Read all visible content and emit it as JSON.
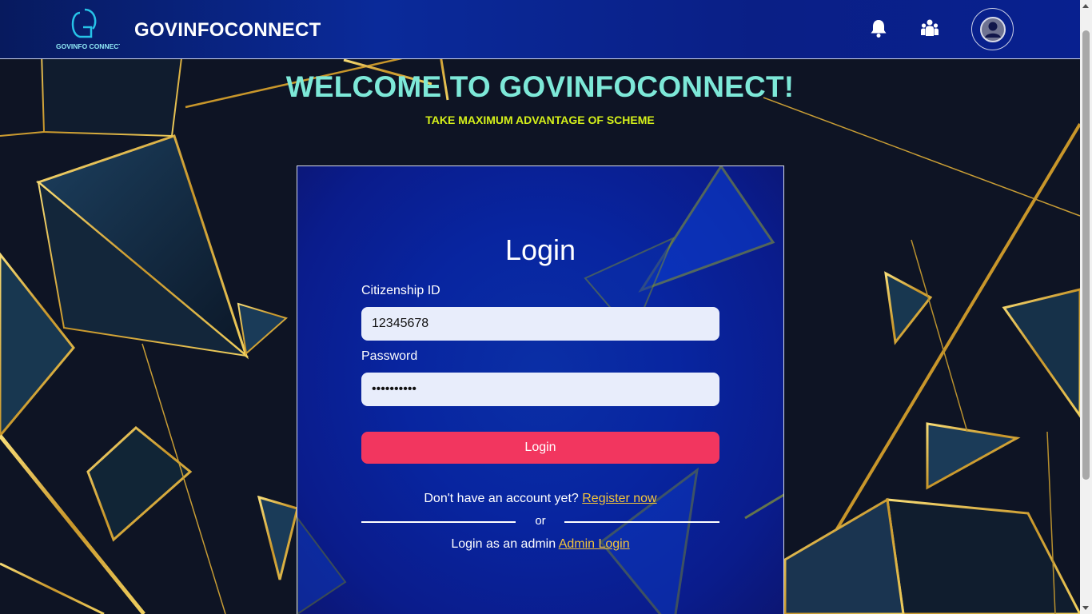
{
  "header": {
    "logo_text": "GOVINFO CONNECT",
    "brand": "GOVINFOCONNECT",
    "icons": [
      "bell-icon",
      "people-icon",
      "user-avatar-icon"
    ]
  },
  "hero": {
    "welcome": "WELCOME TO GOVINFOCONNECT!",
    "tagline": "TAKE MAXIMUM ADVANTAGE OF SCHEME"
  },
  "login_card": {
    "title": "Login",
    "citizenship_label": "Citizenship ID",
    "citizenship_value": "12345678",
    "password_label": "Password",
    "password_value": "••••••••••",
    "login_button": "Login",
    "register_prompt": "Don't have an account yet?",
    "register_link": "Register now",
    "or_text": "or",
    "admin_prompt": "Login as an admin",
    "admin_link": "Admin Login"
  },
  "colors": {
    "header_bg": "#0a2a9a",
    "welcome_text": "#7de8d8",
    "tagline_text": "#d5f01a",
    "login_button": "#f2365f",
    "link": "#f4c53a",
    "gold_lines": "#d8b13a"
  }
}
